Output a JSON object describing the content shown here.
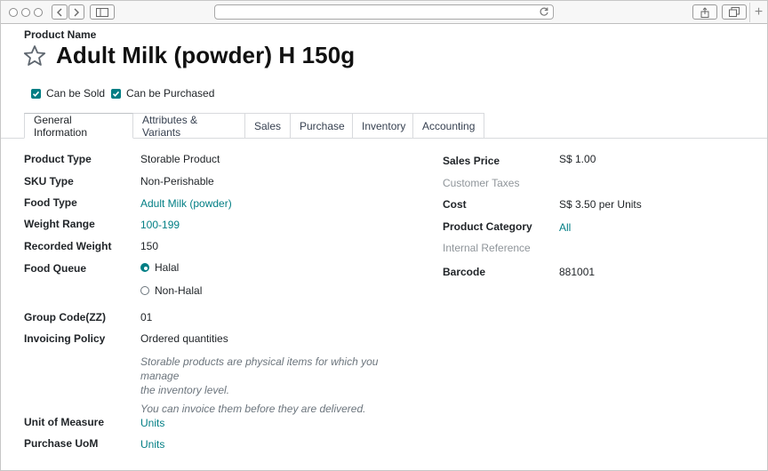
{
  "form": {
    "product_name_label": "Product Name",
    "product_name": "Adult Milk (powder) H 150g",
    "can_be_sold_label": "Can be Sold",
    "can_be_sold": true,
    "can_be_purchased_label": "Can be Purchased",
    "can_be_purchased": true
  },
  "tabs": [
    {
      "label": "General Information",
      "active": true
    },
    {
      "label": "Attributes & Variants",
      "active": false
    },
    {
      "label": "Sales",
      "active": false
    },
    {
      "label": "Purchase",
      "active": false
    },
    {
      "label": "Inventory",
      "active": false
    },
    {
      "label": "Accounting",
      "active": false
    }
  ],
  "general": {
    "product_type": {
      "label": "Product Type",
      "value": "Storable Product"
    },
    "sku_type": {
      "label": "SKU Type",
      "value": "Non-Perishable"
    },
    "food_type": {
      "label": "Food Type",
      "value": "Adult Milk (powder)"
    },
    "weight_range": {
      "label": "Weight Range",
      "value": "100-199"
    },
    "recorded_weight": {
      "label": "Recorded Weight",
      "value": "150"
    },
    "food_queue": {
      "label": "Food Queue",
      "options": [
        "Halal",
        "Non-Halal"
      ],
      "selected": "Halal"
    },
    "group_code": {
      "label": "Group Code(ZZ)",
      "value": "01"
    },
    "invoicing_policy": {
      "label": "Invoicing Policy",
      "value": "Ordered quantities",
      "help_1a": "Storable products are physical items for which you manage",
      "help_1b": "the inventory level.",
      "help_2": "You can invoice them before they are delivered."
    },
    "unit_of_measure": {
      "label": "Unit of Measure",
      "value": "Units"
    },
    "purchase_uom": {
      "label": "Purchase UoM",
      "value": "Units"
    }
  },
  "pricing": {
    "sales_price": {
      "label": "Sales Price",
      "value": "S$ 1.00"
    },
    "customer_taxes": {
      "label": "Customer Taxes",
      "value": ""
    },
    "cost": {
      "label": "Cost",
      "value": "S$ 3.50",
      "unit": "per Units"
    },
    "product_category": {
      "label": "Product Category",
      "value": "All"
    },
    "internal_reference": {
      "label": "Internal Reference",
      "value": ""
    },
    "barcode": {
      "label": "Barcode",
      "value": "881001"
    }
  },
  "colors": {
    "accent": "#017e84",
    "muted": "#8f959a"
  }
}
